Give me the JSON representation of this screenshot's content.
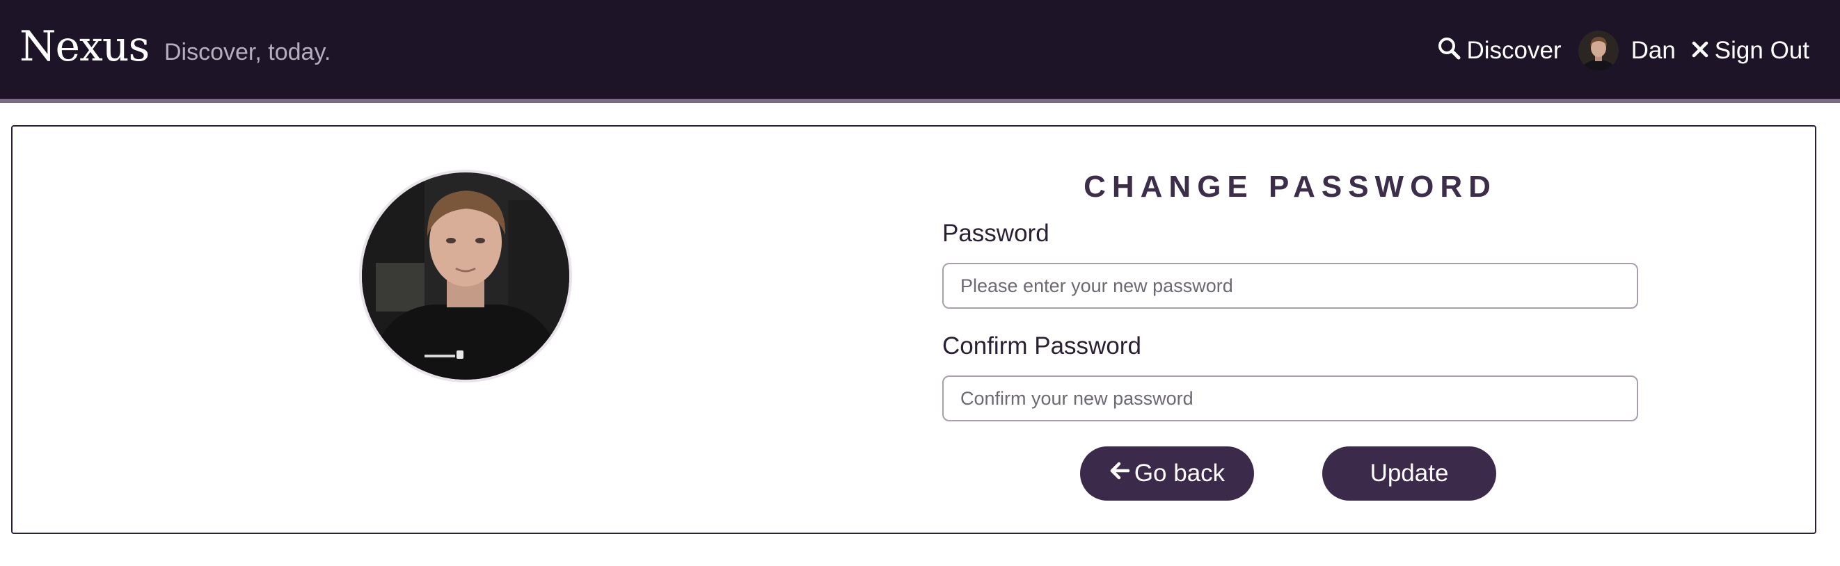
{
  "navbar": {
    "brand": "Nexus",
    "tagline": "Discover, today.",
    "discover_label": "Discover",
    "user_name": "Dan",
    "signout_label": "Sign Out"
  },
  "form": {
    "title": "CHANGE PASSWORD",
    "password_label": "Password",
    "password_placeholder": "Please enter your new password",
    "password_value": "",
    "confirm_label": "Confirm Password",
    "confirm_placeholder": "Confirm your new password",
    "confirm_value": "",
    "back_label": "Go back",
    "update_label": "Update"
  },
  "icons": {
    "search": "search-icon",
    "close": "close-icon",
    "back": "arrow-left-icon"
  },
  "colors": {
    "navbar_bg": "#1e1427",
    "accent": "#3c2a4b",
    "title": "#3c2e4a"
  }
}
